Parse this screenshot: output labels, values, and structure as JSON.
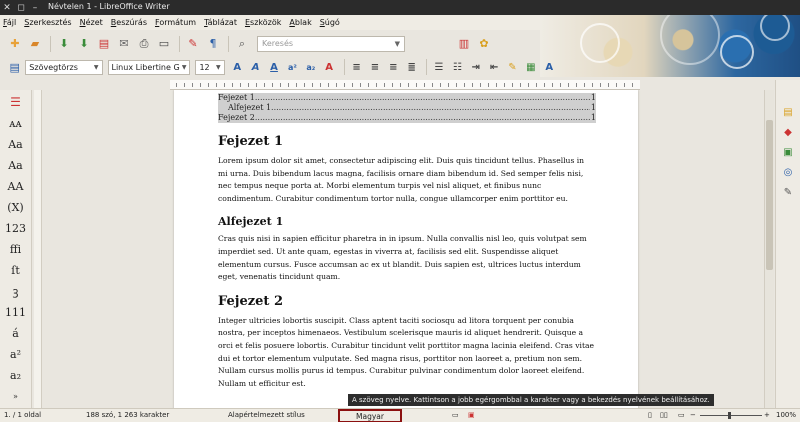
{
  "window": {
    "title": "Névtelen 1 - LibreOffice Writer"
  },
  "menu": [
    "Fájl",
    "Szerkesztés",
    "Nézet",
    "Beszúrás",
    "Formátum",
    "Táblázat",
    "Eszközök",
    "Ablak",
    "Súgó"
  ],
  "toolbar": {
    "search_placeholder": "Keresés"
  },
  "formatting": {
    "paragraph_style": "Szövegtörzs",
    "font_name": "Linux Libertine G",
    "font_size": "12"
  },
  "left_panel": {
    "buttons": [
      "ᴀᴀ",
      "Aa",
      "Aa",
      "AA",
      "(X)",
      "123",
      "ffi",
      "ſt",
      "ꝫ",
      "111",
      "á",
      "a²",
      "a₂"
    ]
  },
  "document": {
    "toc": [
      {
        "label": "Fejezet 1",
        "page": "1",
        "level": 1
      },
      {
        "label": "Alfejezet 1",
        "page": "1",
        "level": 2
      },
      {
        "label": "Fejezet 2",
        "page": "1",
        "level": 1
      }
    ],
    "heading1": "Fejezet 1",
    "para1_parts": [
      {
        "t": "Lorem ipsum dolor sit amet, consectetur adipiscing elit. Duis quis tincidunt tellus. Phasellus in mi urna. Duis bibendum lacus magna, facilisis ornare diam bibendum id. Sed semper felis nisi, nec tempus neque porta at. Morbi elementum turpis vel nisl aliquet, et finibus nunc condimentum. Curabitur condimentum tortor nulla, congue ullamcorper enim porttitor eu."
      }
    ],
    "heading2": "Alfejezet 1",
    "para2": "Cras quis nisi in sapien efficitur pharetra in in ipsum. Nulla convallis nisl leo, quis volutpat sem imperdiet sed. Ut ante quam, egestas in viverra at, facilisis sed elit. Suspendisse aliquet elementum cursus. Fusce accumsan ac ex ut blandit. Duis sapien est, ultrices luctus interdum eget, venenatis tincidunt quam.",
    "heading3": "Fejezet 2",
    "para3": "Integer ultricies lobortis suscipit. Class aptent taciti sociosqu ad litora torquent per conubia nostra, per inceptos himenaeos. Vestibulum scelerisque mauris id aliquet hendrerit. Quisque a orci et felis posuere lobortis. Curabitur tincidunt velit porttitor magna lacinia eleifend. Cras vitae dui et tortor elementum vulputate. Sed magna risus, porttitor non laoreet a, pretium non sem. Nullam cursus mollis purus id tempus. Curabitur pulvinar condimentum dolor laoreet eleifend. Nullam ut efficitur est."
  },
  "status": {
    "page": "1. / 1 oldal",
    "words": "188 szó, 1 263 karakter",
    "page_style": "Alapértelmezett stílus",
    "language": "Magyar",
    "zoom": "100%",
    "tooltip": "A szöveg nyelve. Kattintson a jobb egérgombbal a karakter vagy a bekezdés nyelvének beállításához."
  }
}
